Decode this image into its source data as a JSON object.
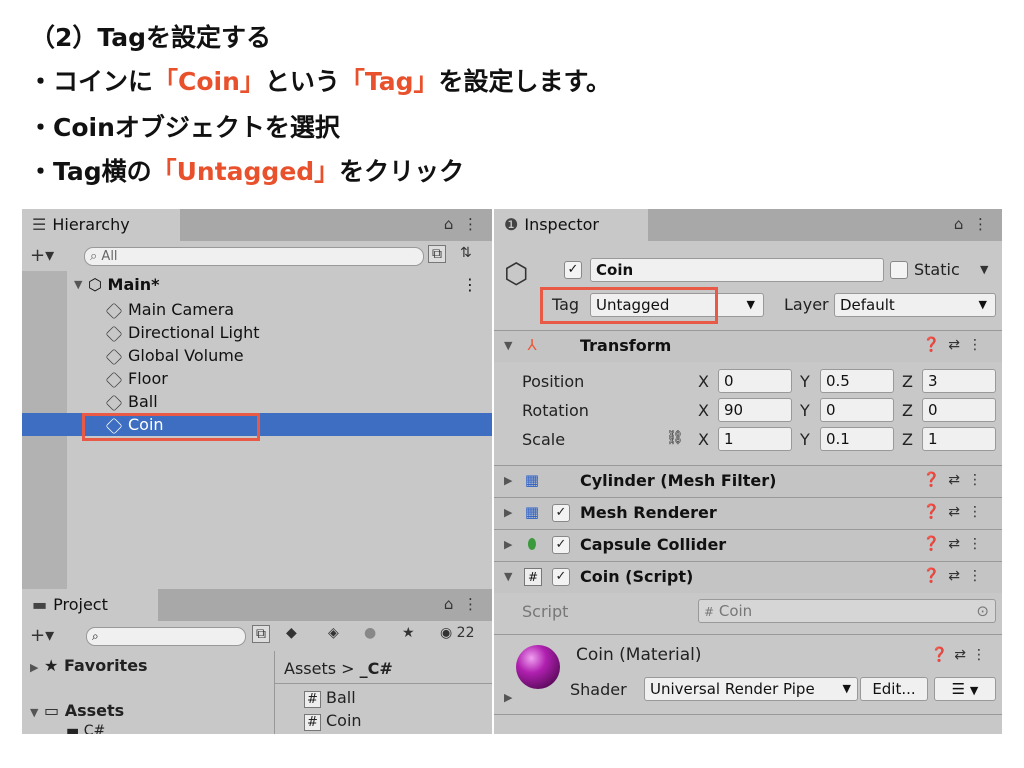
{
  "captions": {
    "line1": "（2）Tagを設定する",
    "line2_pre": "・コインに",
    "line2_hl1": "「Coin」",
    "line2_mid": "という",
    "line2_hl2": "「Tag」",
    "line2_post": "を設定します。",
    "line3": "・Coinオブジェクトを選択",
    "line4_pre": "・Tag横の",
    "line4_hl": "「Untagged」",
    "line4_post": "をクリック"
  },
  "hierarchy": {
    "tab_label": "Hierarchy",
    "search_placeholder": "All",
    "scene_name": "Main*",
    "items": [
      "Main Camera",
      "Directional Light",
      "Global Volume",
      "Floor",
      "Ball",
      "Coin"
    ],
    "selected": "Coin"
  },
  "project": {
    "tab_label": "Project",
    "favorites": "Favorites",
    "assets": "Assets",
    "sub_folder": "C#",
    "breadcrumb_root": "Assets",
    "breadcrumb_sep": ">",
    "breadcrumb_leaf": "_C#",
    "files": [
      "Ball",
      "Coin"
    ],
    "visible_count": "22"
  },
  "inspector": {
    "tab_label": "Inspector",
    "object_name": "Coin",
    "static_label": "Static",
    "tag_label": "Tag",
    "tag_value": "Untagged",
    "layer_label": "Layer",
    "layer_value": "Default",
    "transform": {
      "title": "Transform",
      "rows": [
        {
          "label": "Position",
          "x": "0",
          "y": "0.5",
          "z": "3"
        },
        {
          "label": "Rotation",
          "x": "90",
          "y": "0",
          "z": "0"
        },
        {
          "label": "Scale",
          "x": "1",
          "y": "0.1",
          "z": "1"
        }
      ]
    },
    "components": [
      {
        "name": "Cylinder (Mesh Filter)",
        "has_check": false,
        "icon": "grid-icon"
      },
      {
        "name": "Mesh Renderer",
        "has_check": true,
        "icon": "mesh-renderer-icon"
      },
      {
        "name": "Capsule Collider",
        "has_check": true,
        "icon": "capsule-icon"
      },
      {
        "name": "Coin (Script)",
        "has_check": true,
        "icon": "script-icon",
        "expanded": true
      }
    ],
    "script_label": "Script",
    "script_value": "Coin",
    "material_name": "Coin (Material)",
    "shader_label": "Shader",
    "shader_value": "Universal Render Pipe",
    "edit_button": "Edit..."
  },
  "colors": {
    "highlight": "#e8512b",
    "selection": "#3d6ec2",
    "redbox": "#e85a45"
  }
}
